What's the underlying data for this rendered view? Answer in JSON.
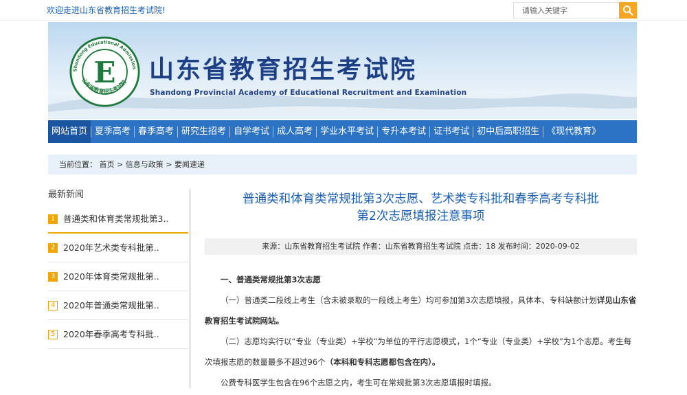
{
  "topbar": {
    "welcome": "欢迎走进山东省教育招生考试院!",
    "search_placeholder": "请输入关键字"
  },
  "banner": {
    "title": "山东省教育招生考试院",
    "subtitle": "Shandong Provincial Academy of Educational Recruitment and Examination",
    "emblem_ring_en": "Shandong Educational Admission & Examination",
    "emblem_ring_cn": "山东省教育招生考试院",
    "emblem_letter": "E"
  },
  "nav": {
    "items": [
      "网站首页",
      "夏季高考",
      "春季高考",
      "研究生招考",
      "自学考试",
      "成人高考",
      "学业水平考试",
      "专升本考试",
      "证书考试",
      "初中后高职招生",
      "《现代教育》"
    ]
  },
  "breadcrumb": {
    "label": "当前位置：",
    "home": "首页",
    "section": "信息与政策",
    "current": "要闻速递",
    "sep": ">"
  },
  "sidebar": {
    "title": "最新新闻",
    "items": [
      {
        "num": "1",
        "label": "普通类和体育类常规批第3.."
      },
      {
        "num": "2",
        "label": "2020年艺术类专科批第.."
      },
      {
        "num": "3",
        "label": "2020年体育类常规批第.."
      },
      {
        "num": "4",
        "label": "2020年普通类常规批第.."
      },
      {
        "num": "5",
        "label": "2020年春季高考专科批.."
      }
    ]
  },
  "article": {
    "title_line1": "普通类和体育类常规批第3次志愿、艺术类专科批和春季高考专科批",
    "title_line2": "第2次志愿填报注意事项",
    "meta": "来源：山东省教育招生考试院 作者：山东省教育招生考试院 点击：18 发布时间：2020-09-02",
    "section1": "一、普通类常规批第3次志愿",
    "p1a": "（一）普通类二段线上考生（含未被录取的一段线上考生）均可参加第3次志愿填报，具体本、专科缺额计划",
    "p1b": "详见山东省教育招生考试院网站。",
    "p2a": "（二）志愿均实行以“专业（专业类）+学校”为单位的平行志愿模式，1个“专业（专业类）+学校”为1个志愿。考生每次填报志愿的数量最多不超过96个",
    "p2b": "（本科和专科志愿都包含在内）。",
    "p3": "公费专科医学生包含在96个志愿之内，考生可在常规批第3次志愿填报时填报。"
  },
  "colors": {
    "nav_bg": "#2d73c4",
    "nav_active": "#1a55a2",
    "accent_orange": "#f0a500",
    "link_blue": "#1a5fb4",
    "banner_title": "#1d3f86"
  },
  "icons": {
    "search": "magnifier-icon",
    "emblem": "academy-emblem-icon"
  }
}
